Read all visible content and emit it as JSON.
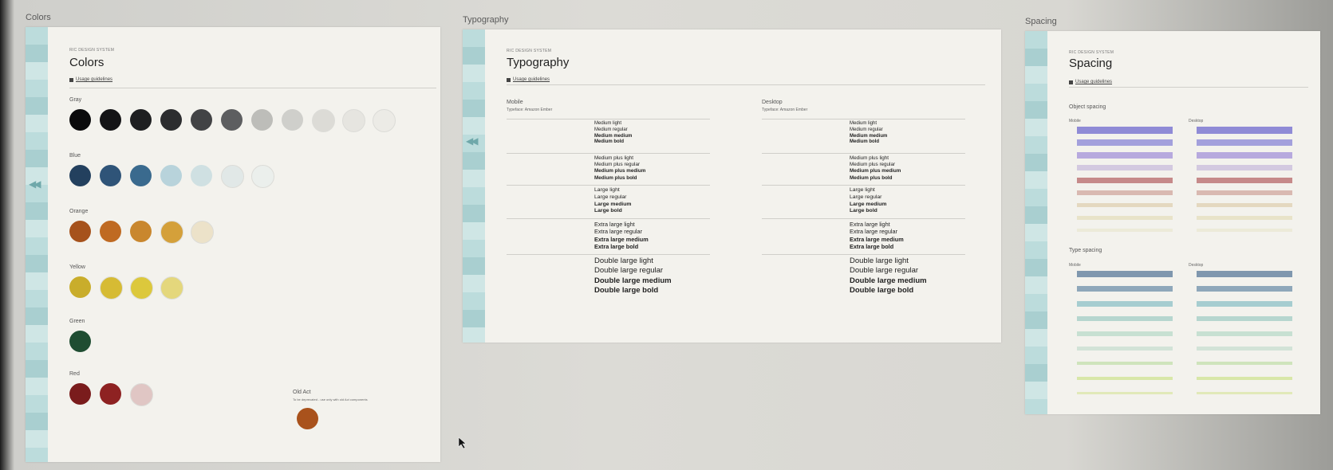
{
  "labels": {
    "colors": "Colors",
    "typography": "Typography",
    "spacing": "Spacing"
  },
  "eyebrow": "RIC DESIGN SYSTEM",
  "guide_link": "Usage guidelines",
  "colors": {
    "title": "Colors",
    "groups": [
      {
        "name": "Gray",
        "swatches": [
          "#0b0b0c",
          "#141416",
          "#1e1f21",
          "#2c2d2f",
          "#424345",
          "#5d5e60",
          "#bdbdb9",
          "#cfcfcb",
          "#dcdbd6",
          "#e6e5e0",
          "#ecebe6"
        ]
      },
      {
        "name": "Blue",
        "swatches": [
          "#23405e",
          "#2f5478",
          "#3a6a8e",
          "#b8d3db",
          "#cfe0e2",
          "#e1e8e7",
          "#ebefec"
        ]
      },
      {
        "name": "Orange",
        "swatches": [
          "#a6521c",
          "#bf6a22",
          "#c9872e",
          "#d4a03a",
          "#ece2c9"
        ]
      },
      {
        "name": "Yellow",
        "swatches": [
          "#c9ad2b",
          "#d6bb34",
          "#dcc83c",
          "#e4d77c"
        ]
      },
      {
        "name": "Green",
        "swatches": [
          "#1f4d32"
        ]
      },
      {
        "name": "Red",
        "swatches": [
          "#7a1c1c",
          "#8e2222",
          "#e0c6c4"
        ]
      }
    ],
    "old_act": {
      "title": "Old Act",
      "subtitle": "To be deprecated - use only with old Act components",
      "swatch": "#a9521c"
    }
  },
  "typography": {
    "title": "Typography",
    "mobile": "Mobile",
    "desktop": "Desktop",
    "typeface": "Typeface: Amazon Ember",
    "styles": [
      [
        "Medium light",
        "Medium regular",
        "Medium medium",
        "Medium bold"
      ],
      [
        "Medium plus light",
        "Medium plus regular",
        "Medium plus medium",
        "Medium plus bold"
      ],
      [
        "Large light",
        "Large regular",
        "Large medium",
        "Large bold"
      ],
      [
        "Extra large light",
        "Extra large regular",
        "Extra large medium",
        "Extra large bold"
      ],
      [
        "Double large light",
        "Double large regular",
        "Double large medium",
        "Double large bold"
      ]
    ]
  },
  "spacing": {
    "title": "Spacing",
    "object_spacing": "Object spacing",
    "type_spacing": "Type spacing",
    "mobile": "Mobile",
    "desktop": "Desktop",
    "object_bars": [
      "#8f8bd6",
      "#a3a0dc",
      "#b7a9de",
      "#d3c9e0",
      "#c68a8a",
      "#d9b9b1",
      "#e4d8c0",
      "#e8e3c9",
      "#ecead8"
    ],
    "type_bars": [
      "#7f97ae",
      "#8ea7ba",
      "#a6cdd0",
      "#b6d6cf",
      "#c7e0d2",
      "#d2e3d7",
      "#cfe4bc",
      "#d8e7a8",
      "#e1e9b9"
    ]
  }
}
